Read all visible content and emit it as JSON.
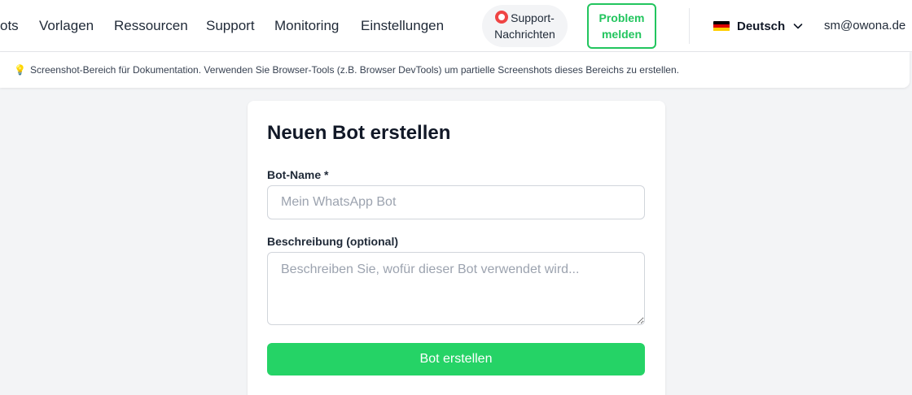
{
  "header": {
    "nav": [
      {
        "label": "ots"
      },
      {
        "label": "Vorlagen"
      },
      {
        "label": "Ressourcen"
      },
      {
        "label": "Support"
      },
      {
        "label": "Monitoring"
      },
      {
        "label": "Einstellungen"
      }
    ],
    "support_messages": {
      "line1": "Support-",
      "line2": "Nachrichten",
      "icon": "lifebuoy-icon"
    },
    "report_problem": {
      "line1": "Problem",
      "line2": "melden",
      "color": "#22c55e"
    },
    "language": {
      "label": "Deutsch",
      "flag": "flag-de-icon",
      "chevron": "chevron-down-icon"
    },
    "user_email": "sm@owona.de"
  },
  "hint": {
    "icon": "lightbulb-icon",
    "text": "Screenshot-Bereich für Dokumentation. Verwenden Sie Browser-Tools (z.B. Browser DevTools) um partielle Screenshots dieses Bereichs zu erstellen."
  },
  "form": {
    "title": "Neuen Bot erstellen",
    "name_label": "Bot-Name *",
    "name_value": "",
    "name_placeholder": "Mein WhatsApp Bot",
    "description_label": "Beschreibung (optional)",
    "description_value": "",
    "description_placeholder": "Beschreiben Sie, wofür dieser Bot verwendet wird...",
    "submit_label": "Bot erstellen",
    "accent_color": "#25d366"
  }
}
